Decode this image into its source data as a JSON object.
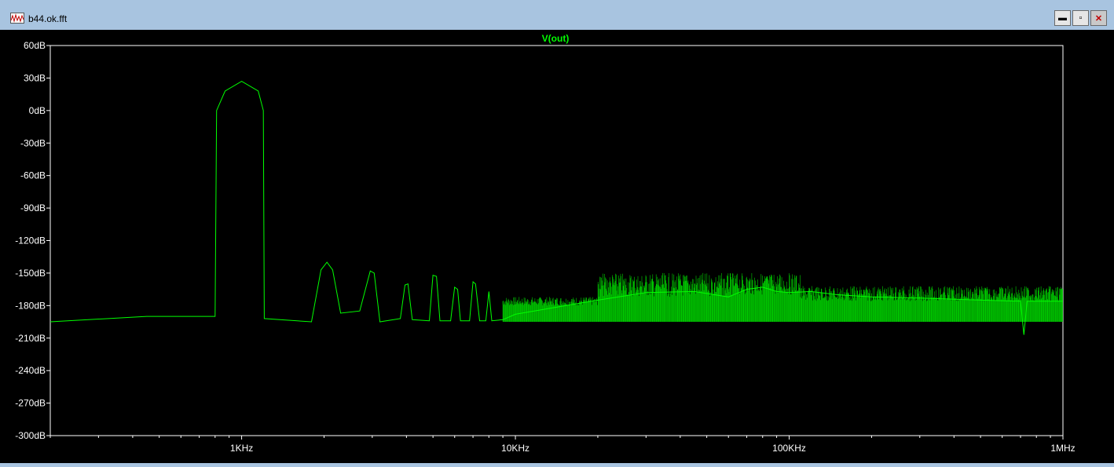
{
  "window": {
    "title": "b44.ok.fft",
    "buttons": {
      "minimize": "▬",
      "restore": "▫",
      "close": "✕"
    }
  },
  "colors": {
    "trace": "#00ff00",
    "axis": "#ffffff",
    "background": "#000000",
    "frame": "#a8c4e0"
  },
  "chart_data": {
    "type": "line",
    "title": "V(out)",
    "xscale": "log",
    "xlim": [
      200,
      1000000
    ],
    "ylim": [
      -300,
      60
    ],
    "xticks": [
      {
        "value": 1000,
        "label": "1KHz"
      },
      {
        "value": 10000,
        "label": "10KHz"
      },
      {
        "value": 100000,
        "label": "100KHz"
      },
      {
        "value": 1000000,
        "label": "1MHz"
      }
    ],
    "yticks": [
      {
        "value": 60,
        "label": "60dB"
      },
      {
        "value": 30,
        "label": "30dB"
      },
      {
        "value": 0,
        "label": "0dB"
      },
      {
        "value": -30,
        "label": "-30dB"
      },
      {
        "value": -60,
        "label": "-60dB"
      },
      {
        "value": -90,
        "label": "-90dB"
      },
      {
        "value": -120,
        "label": "-120dB"
      },
      {
        "value": -150,
        "label": "-150dB"
      },
      {
        "value": -180,
        "label": "-180dB"
      },
      {
        "value": -210,
        "label": "-210dB"
      },
      {
        "value": -240,
        "label": "-240dB"
      },
      {
        "value": -270,
        "label": "-270dB"
      },
      {
        "value": -300,
        "label": "-300dB"
      }
    ],
    "series": [
      {
        "name": "V(out)",
        "x": [
          200,
          450,
          800,
          810,
          870,
          1000,
          1150,
          1200,
          1210,
          1800,
          1950,
          2050,
          2150,
          2300,
          2700,
          2950,
          3050,
          3200,
          3800,
          3950,
          4050,
          4200,
          4850,
          5000,
          5150,
          5300,
          5800,
          6000,
          6150,
          6300,
          6800,
          7000,
          7150,
          7400,
          7800,
          8000,
          8200,
          9000,
          10000,
          20000,
          30000,
          45000,
          60000,
          70000,
          80000,
          90000,
          100000,
          120000,
          150000,
          200000,
          300000,
          500000,
          700000,
          720000,
          740000,
          1000000
        ],
        "y": [
          -195,
          -190,
          -190,
          0,
          18,
          27,
          18,
          0,
          -192,
          -195,
          -147,
          -140,
          -147,
          -187,
          -185,
          -148,
          -150,
          -195,
          -192,
          -161,
          -160,
          -193,
          -194,
          -152,
          -153,
          -194,
          -194,
          -163,
          -165,
          -194,
          -194,
          -158,
          -160,
          -194,
          -194,
          -167,
          -194,
          -193,
          -188,
          -175,
          -168,
          -167,
          -172,
          -165,
          -163,
          -167,
          -168,
          -167,
          -170,
          -172,
          -173,
          -175,
          -176,
          -207,
          -176,
          -176
        ]
      }
    ]
  }
}
